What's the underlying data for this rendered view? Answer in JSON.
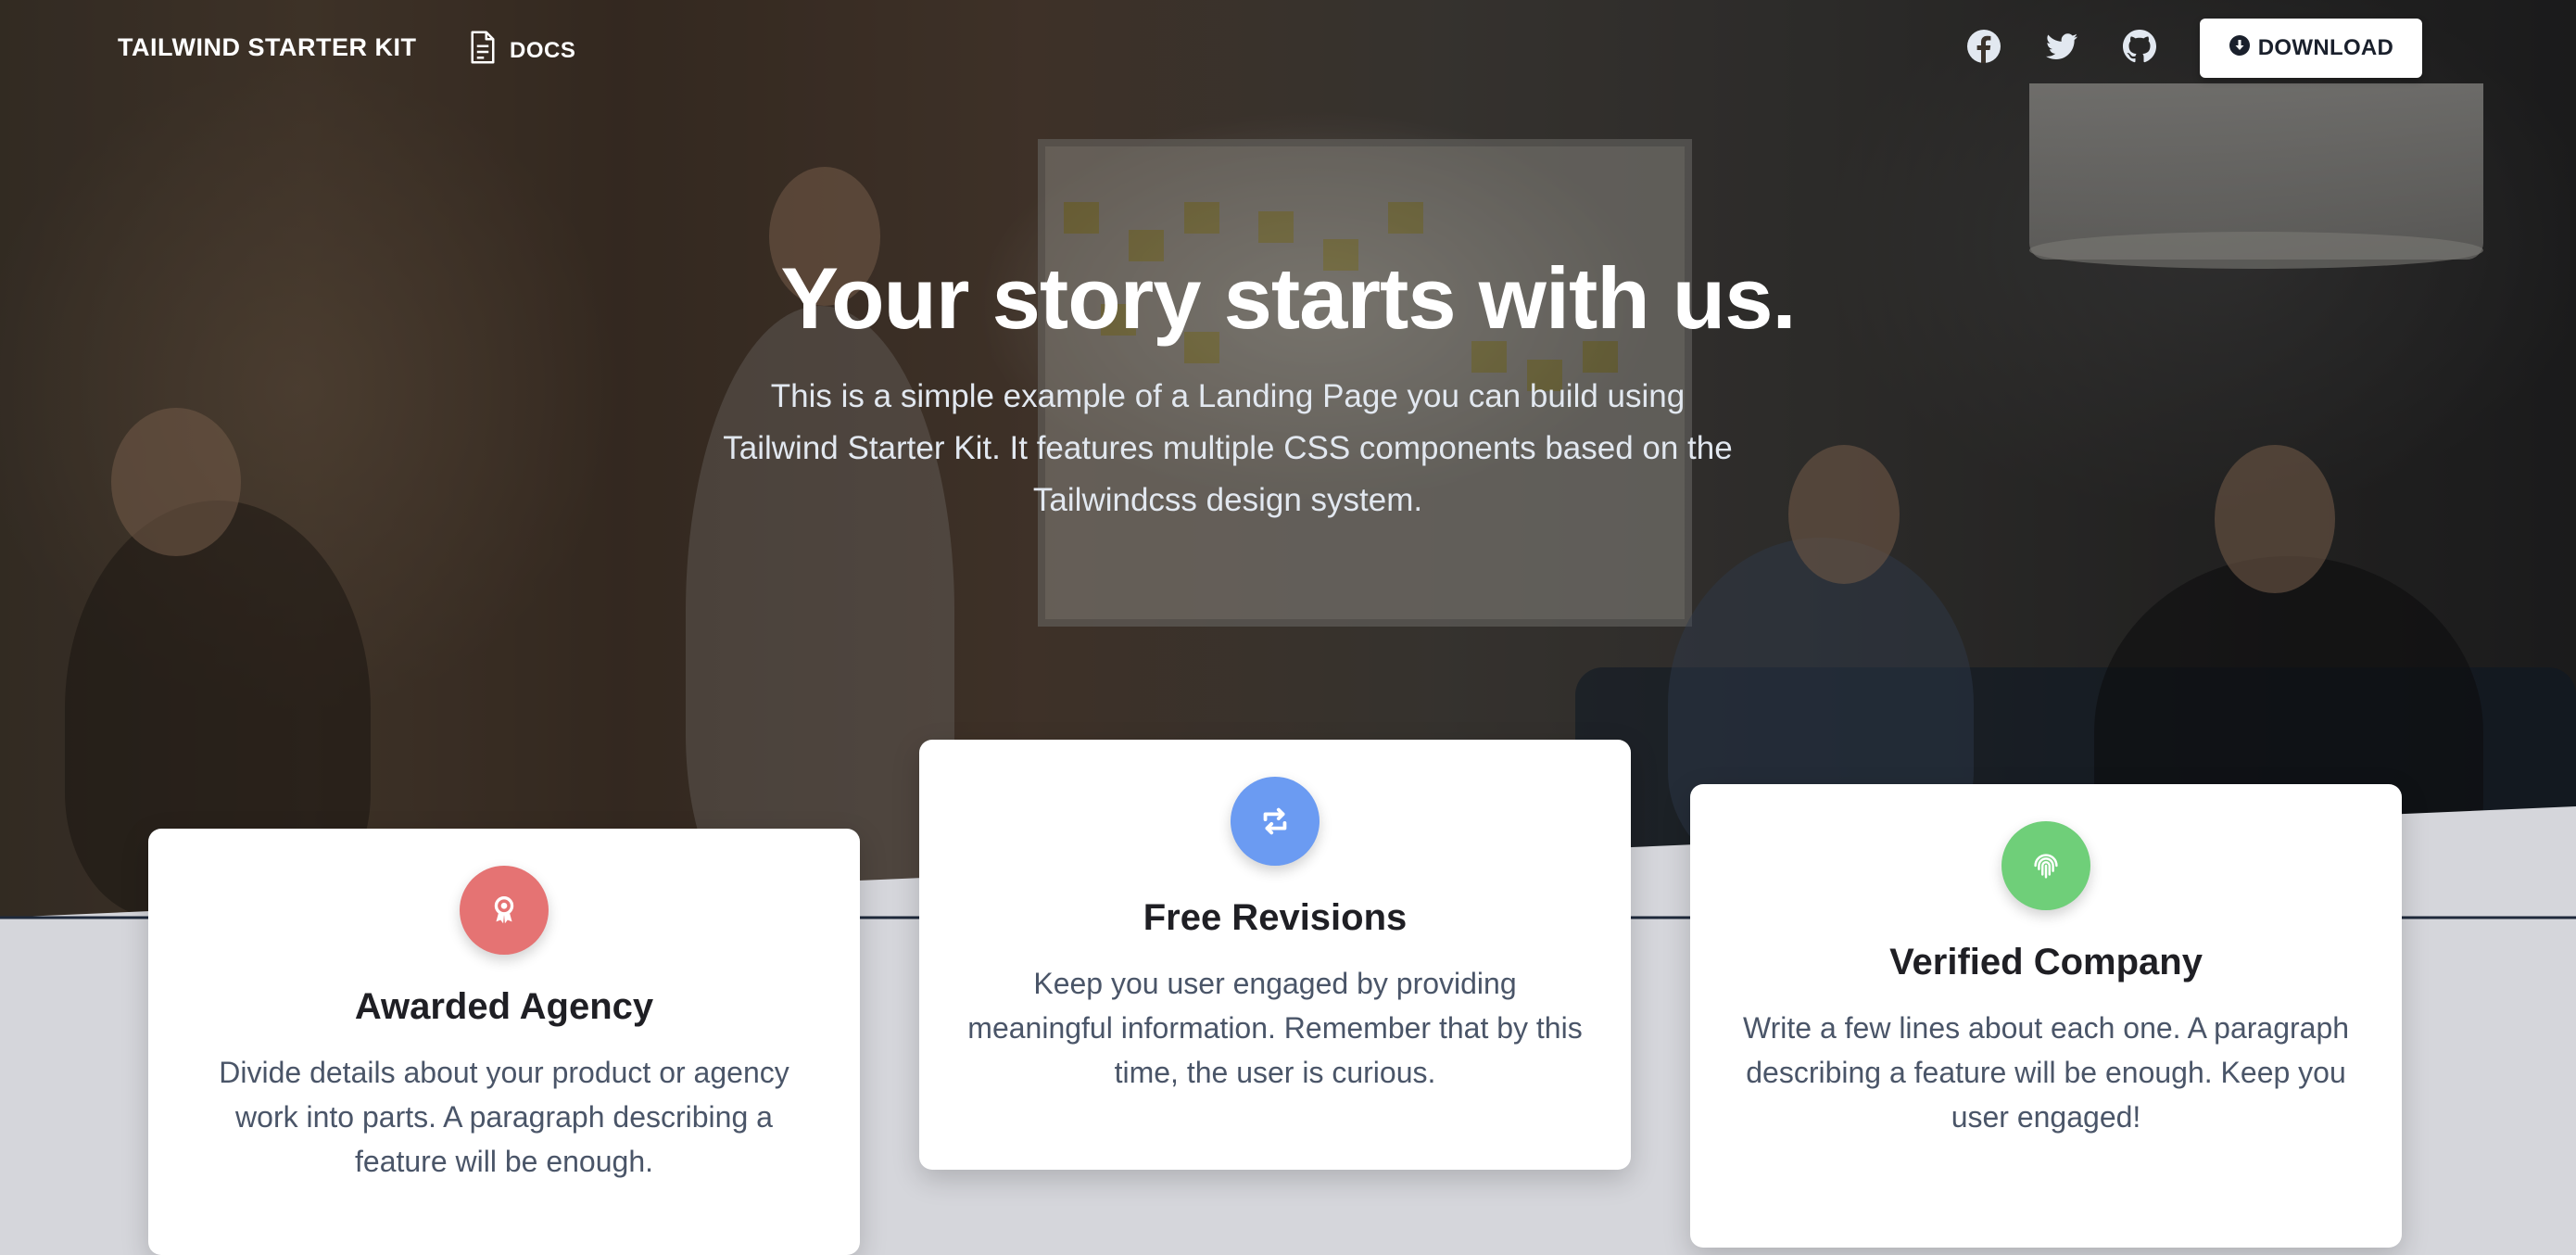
{
  "navbar": {
    "brand": "TAILWIND STARTER KIT",
    "docs_label": "DOCS",
    "download_label": "DOWNLOAD",
    "social": [
      {
        "icon": "facebook-icon"
      },
      {
        "icon": "twitter-icon"
      },
      {
        "icon": "github-icon"
      }
    ]
  },
  "hero": {
    "title": "Your story starts with us.",
    "text": "This is a simple example of a Landing Page you can build using Tailwind Starter Kit. It features multiple CSS components based on the Tailwindcss design system."
  },
  "features": [
    {
      "title": "Awarded Agency",
      "text": "Divide details about your product or agency work into parts. A paragraph describing a feature will be enough.",
      "icon": "award-icon",
      "icon_color": "#e57373"
    },
    {
      "title": "Free Revisions",
      "text": "Keep you user engaged by providing meaningful information. Remember that by this time, the user is curious.",
      "icon": "retweet-icon",
      "icon_color": "#6b9bf2"
    },
    {
      "title": "Verified Company",
      "text": "Write a few lines about each one. A paragraph describing a feature will be enough. Keep you user engaged!",
      "icon": "fingerprint-icon",
      "icon_color": "#6fcf79"
    }
  ],
  "colors": {
    "page_background": "#d5d6db",
    "hero_overlay": "#000000",
    "card_background": "#ffffff",
    "slant_line": "#1e293b"
  }
}
